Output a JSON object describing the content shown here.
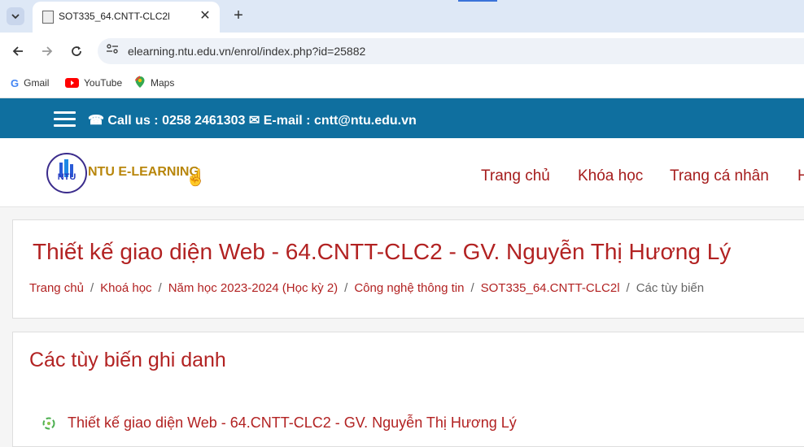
{
  "browser": {
    "tab_title": "SOT335_64.CNTT-CLC2l",
    "tab_close": "✕",
    "new_tab": "+",
    "url": "elearning.ntu.edu.vn/enrol/index.php?id=25882",
    "bookmarks": [
      {
        "label": "Gmail",
        "icon": "gmail-icon"
      },
      {
        "label": "YouTube",
        "icon": "youtube-icon"
      },
      {
        "label": "Maps",
        "icon": "maps-icon"
      }
    ]
  },
  "site": {
    "contact": {
      "call_label": "Call us : 0258 2461303",
      "email_label": "E-mail : cntt@ntu.edu.vn"
    },
    "logo": {
      "text": "NTU E-LEARNING",
      "emblem": "NTU"
    },
    "nav": [
      "Trang chủ",
      "Khóa học",
      "Trang cá nhân",
      "H"
    ],
    "colors": {
      "topbar": "#0f6f9f",
      "accent": "#b22222"
    }
  },
  "page": {
    "title": "Thiết kế giao diện Web - 64.CNTT-CLC2 - GV. Nguyễn Thị Hương Lý",
    "breadcrumb": [
      "Trang chủ",
      "Khoá học",
      "Năm học 2023-2024 (Học kỳ 2)",
      "Công nghệ thông tin",
      "SOT335_64.CNTT-CLC2l",
      "Các tùy biến"
    ],
    "section_title": "Các tùy biến ghi danh",
    "course_link": "Thiết kế giao diện Web - 64.CNTT-CLC2 - GV. Nguyễn Thị Hương Lý"
  }
}
